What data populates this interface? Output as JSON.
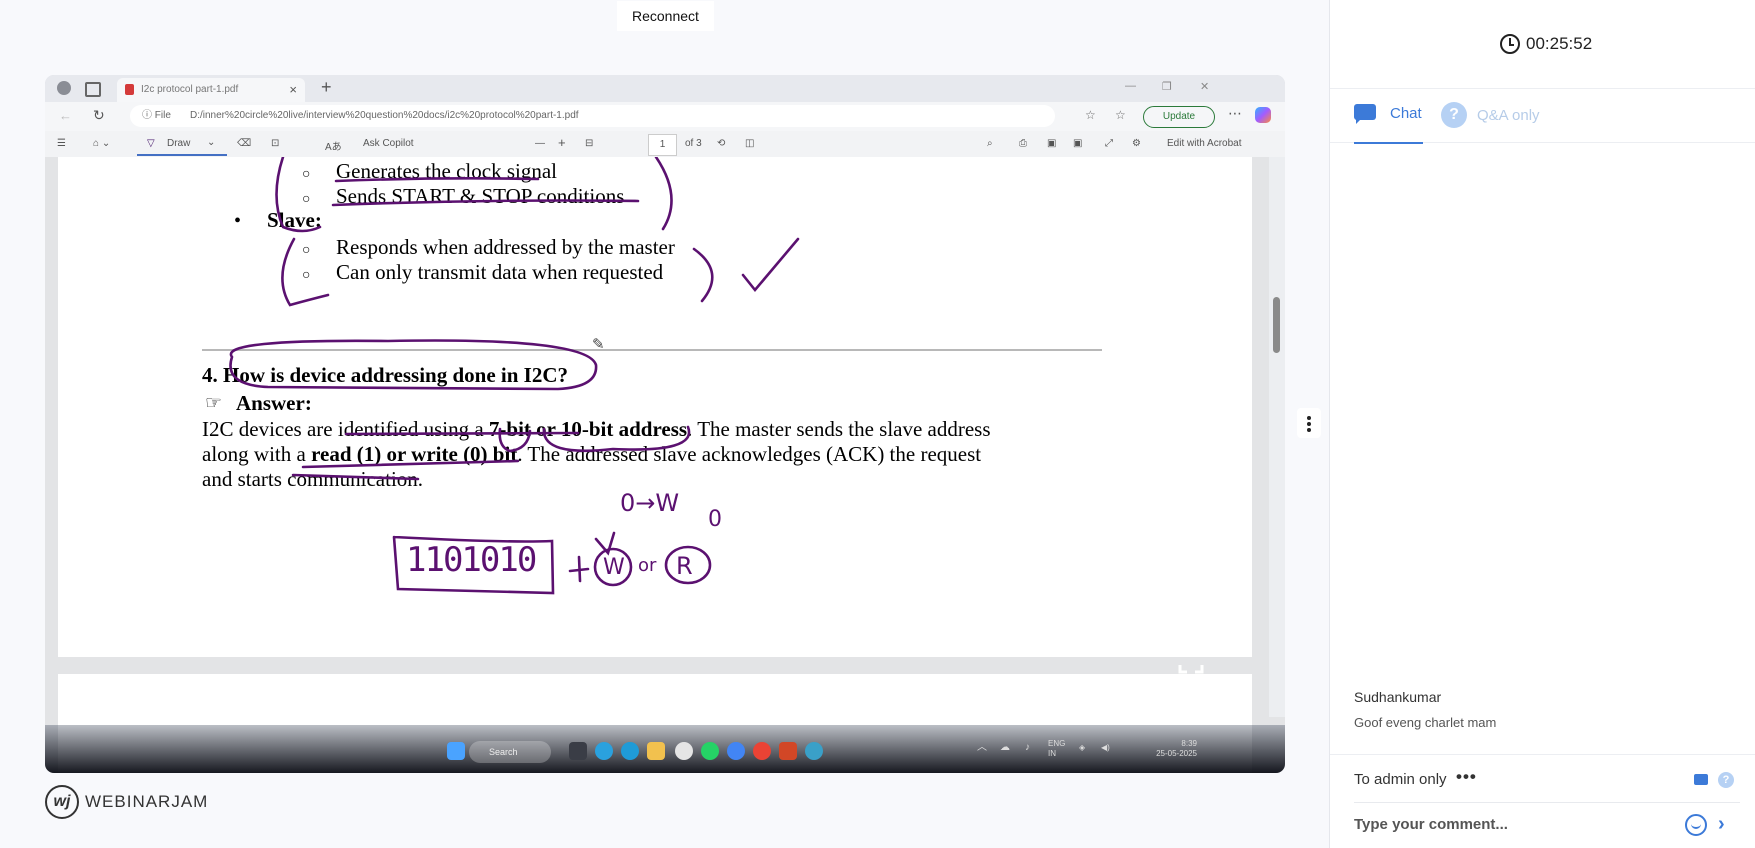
{
  "reconnect_label": "Reconnect",
  "browser": {
    "tab_title": "I2c protocol part-1.pdf",
    "address_prefix": "File",
    "url": "D:/inner%20circle%20live/interview%20question%20docs/i2c%20protocol%20part-1.pdf",
    "update_label": "Update",
    "toolbar": {
      "draw_label": "Draw",
      "ask_copilot": "Ask Copilot",
      "page_number": "1",
      "page_total": "of 3",
      "edit_label": "Edit with Acrobat"
    }
  },
  "pdf": {
    "master_items": [
      "Generates the clock signal",
      "Sends START & STOP conditions"
    ],
    "slave_heading": "Slave:",
    "slave_items": [
      "Responds when addressed by the master",
      "Can only transmit data when requested"
    ],
    "question": "4. How is device addressing done in I2C?",
    "answer_label": "Answer:",
    "answer_line1_a": "I2C devices are identified using a ",
    "answer_line1_b": "7-bit or 10-bit address",
    "answer_line1_c": ". The master sends the slave address",
    "answer_line2_a": "along with a ",
    "answer_line2_b": "read (1) or write (0) bit",
    "answer_line2_c": ". The addressed slave acknowledges (ACK) the request",
    "answer_line3": "and starts communication.",
    "annotations": {
      "binary": "1101010",
      "plus": "+",
      "w": "W",
      "or": "or",
      "r": "R",
      "zero_w": "0→W",
      "one": "0"
    }
  },
  "taskbar": {
    "search_label": "Search",
    "lang": "ENG",
    "region": "IN",
    "time": "8:39",
    "date": "25-05-2025"
  },
  "brand": "WEBINARJAM",
  "side": {
    "timer": "00:25:52",
    "tabs": {
      "chat": "Chat",
      "qa": "Q&A only"
    },
    "message": {
      "author": "Sudhankumar",
      "text": "Goof eveng charlet mam"
    },
    "to_admin": "To admin only",
    "dots": "•••",
    "comment_placeholder": "Type your comment..."
  },
  "colors": {
    "accent": "#3c7ad8",
    "ink": "#5b1170",
    "qa_light": "#b6d1f4"
  }
}
